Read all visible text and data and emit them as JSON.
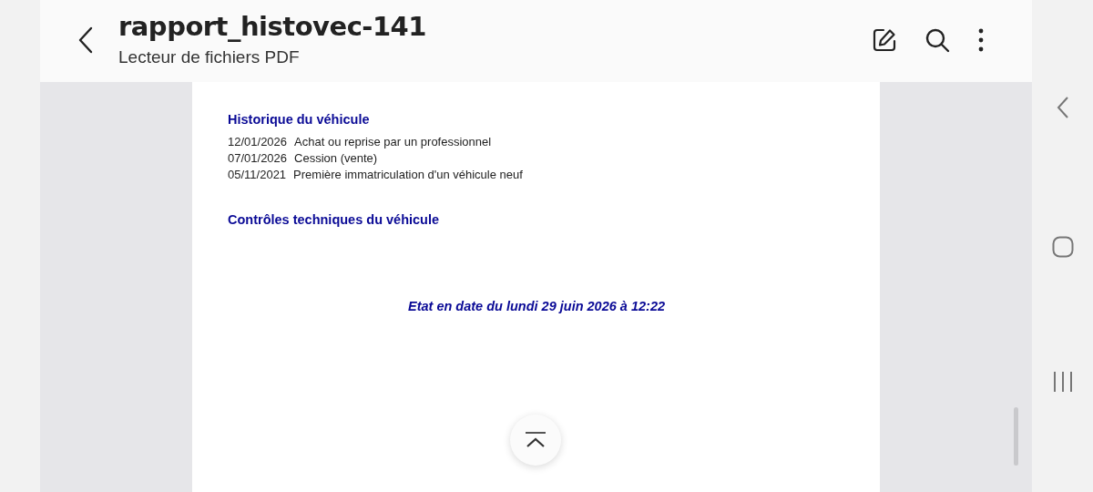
{
  "header": {
    "title": "rapport_histovec-141",
    "subtitle": "Lecteur de fichiers PDF"
  },
  "document": {
    "sections": [
      {
        "kind": "list",
        "heading": "Historique du véhicule",
        "rows": [
          {
            "date": "12/01/2026",
            "event": "Achat ou reprise par un professionnel"
          },
          {
            "date": "07/01/2026",
            "event": "Cession (vente)"
          },
          {
            "date": "05/11/2021",
            "event": "Première immatriculation d'un véhicule neuf"
          }
        ]
      },
      {
        "kind": "heading",
        "heading": "Contrôles techniques du véhicule"
      }
    ],
    "footer_note": "Etat en date du lundi 29 juin 2026 à 12:22"
  }
}
